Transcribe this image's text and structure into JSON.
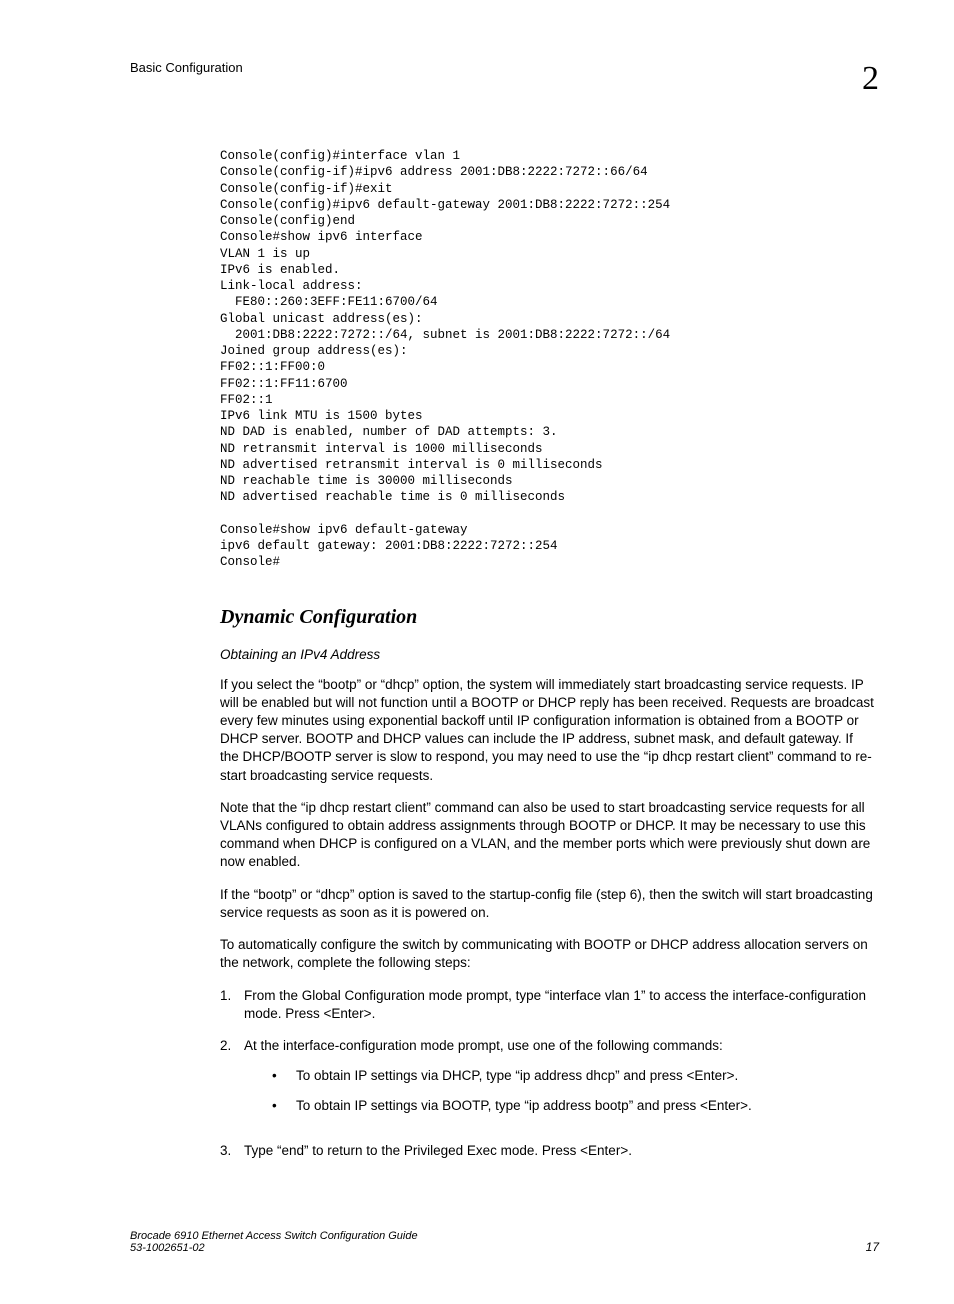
{
  "header": {
    "title": "Basic Configuration",
    "chapter_number": "2"
  },
  "code_block": "Console(config)#interface vlan 1\nConsole(config-if)#ipv6 address 2001:DB8:2222:7272::66/64\nConsole(config-if)#exit\nConsole(config)#ipv6 default-gateway 2001:DB8:2222:7272::254\nConsole(config)end\nConsole#show ipv6 interface\nVLAN 1 is up\nIPv6 is enabled.\nLink-local address:\n  FE80::260:3EFF:FE11:6700/64\nGlobal unicast address(es):\n  2001:DB8:2222:7272::/64, subnet is 2001:DB8:2222:7272::/64\nJoined group address(es):\nFF02::1:FF00:0\nFF02::1:FF11:6700\nFF02::1\nIPv6 link MTU is 1500 bytes\nND DAD is enabled, number of DAD attempts: 3.\nND retransmit interval is 1000 milliseconds\nND advertised retransmit interval is 0 milliseconds\nND reachable time is 30000 milliseconds\nND advertised reachable time is 0 milliseconds\n\nConsole#show ipv6 default-gateway\nipv6 default gateway: 2001:DB8:2222:7272::254\nConsole#",
  "section": {
    "title": "Dynamic Configuration",
    "subsection_title": "Obtaining an IPv4 Address",
    "p1": "If you select the “bootp” or “dhcp” option, the system will immediately start broadcasting service requests. IP will be enabled but will not function until a BOOTP or DHCP reply has been received. Requests are broadcast every few minutes using exponential backoff until IP configuration information is obtained from a BOOTP or DHCP server. BOOTP and DHCP values can include the IP address, subnet mask, and default gateway. If the DHCP/BOOTP server is slow to respond, you may need to use the “ip dhcp restart client” command to re-start broadcasting service requests.",
    "p2": "Note that the “ip dhcp restart client” command can also be used to start broadcasting service requests for all VLANs configured to obtain address assignments through BOOTP or DHCP. It may be necessary to use this command when DHCP is configured on a VLAN, and the member ports which were previously shut down are now enabled.",
    "p3": "If the “bootp” or “dhcp” option is saved to the startup-config file (step 6), then the switch will start broadcasting service requests as soon as it is powered on.",
    "p4": "To automatically configure the switch by communicating with BOOTP or DHCP address allocation servers on the network, complete the following steps:",
    "steps": [
      {
        "num": "1.",
        "text": "From the Global Configuration mode prompt, type “interface vlan 1” to access the interface-configuration mode. Press <Enter>."
      },
      {
        "num": "2.",
        "text": "At the interface-configuration mode prompt, use one of the following commands:",
        "bullets": [
          "To obtain IP settings via DHCP, type “ip address dhcp” and press <Enter>.",
          "To obtain IP settings via BOOTP, type “ip address bootp” and press <Enter>."
        ]
      },
      {
        "num": "3.",
        "text": "Type “end” to return to the Privileged Exec mode. Press <Enter>."
      }
    ]
  },
  "footer": {
    "doc_title": "Brocade 6910 Ethernet Access Switch Configuration Guide",
    "doc_number": "53-1002651-02",
    "page_number": "17"
  }
}
